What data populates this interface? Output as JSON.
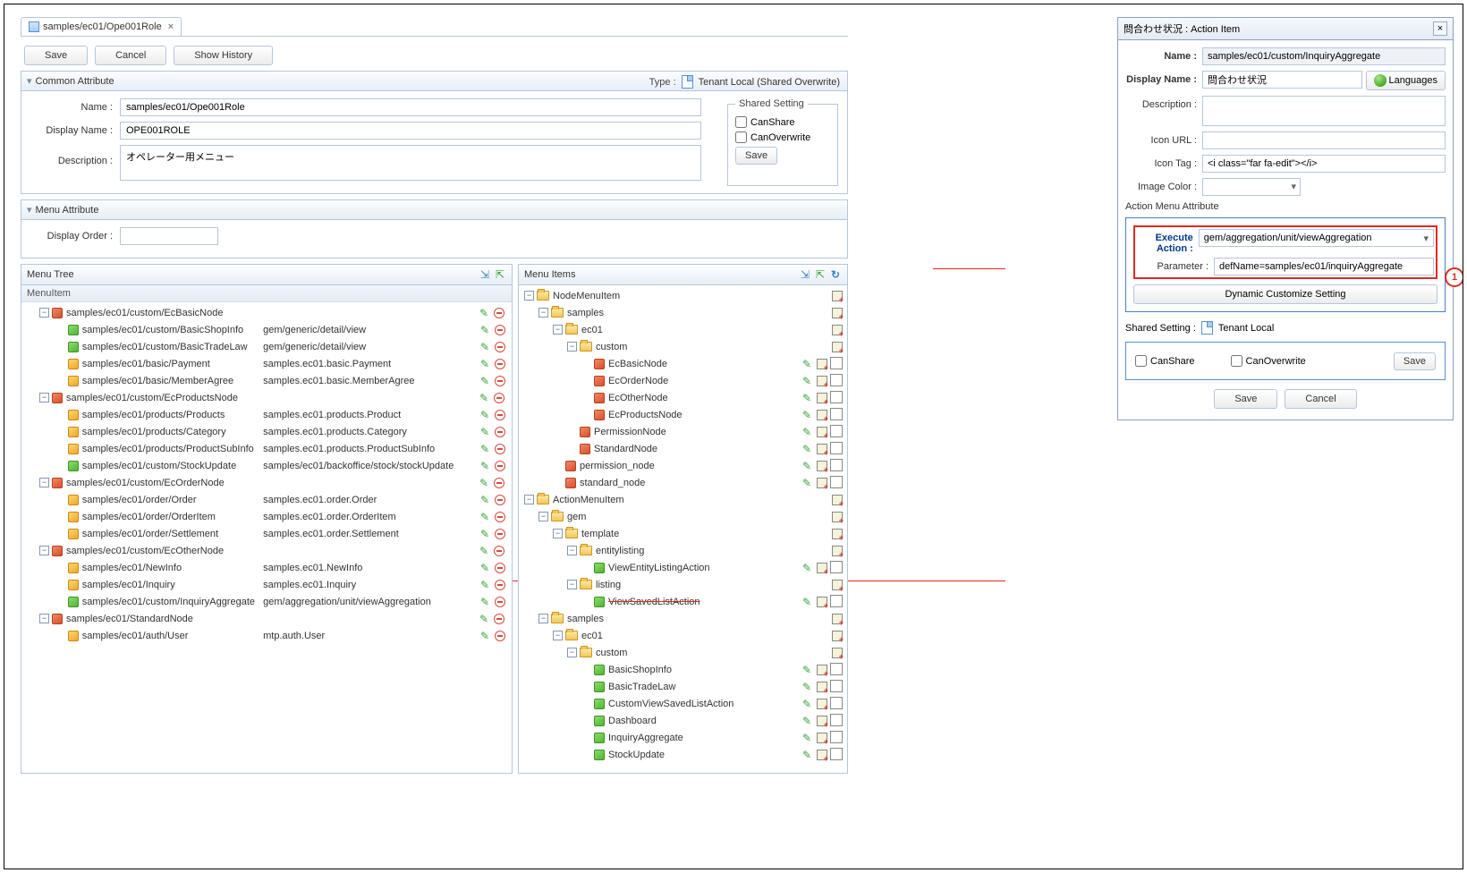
{
  "tab": {
    "title": "samples/ec01/Ope001Role"
  },
  "toolbar": {
    "save": "Save",
    "cancel": "Cancel",
    "history": "Show History"
  },
  "common": {
    "title": "Common Attribute",
    "name_lbl": "Name :",
    "name_val": "samples/ec01/Ope001Role",
    "disp_lbl": "Display Name :",
    "disp_val": "OPE001ROLE",
    "desc_lbl": "Description :",
    "desc_val": "オペレーター用メニュー",
    "type_lbl": "Type :",
    "type_val": "Tenant Local (Shared Overwrite)",
    "fs_title": "Shared Setting",
    "canshare": "CanShare",
    "canover": "CanOverwrite",
    "save": "Save"
  },
  "menuattr": {
    "title": "Menu Attribute",
    "disp_lbl": "Display Order :"
  },
  "panels": {
    "tree": "Menu Tree",
    "items": "Menu Items",
    "menuitem": "MenuItem"
  },
  "left_tree": [
    {
      "d": 0,
      "t": "-",
      "c": "red",
      "l": "samples/ec01/custom/EcBasicNode",
      "m": "",
      "ed": 1
    },
    {
      "d": 1,
      "t": "",
      "c": "green",
      "l": "samples/ec01/custom/BasicShopInfo",
      "m": "gem/generic/detail/view",
      "ed": 1
    },
    {
      "d": 1,
      "t": "",
      "c": "green",
      "l": "samples/ec01/custom/BasicTradeLaw",
      "m": "gem/generic/detail/view",
      "ed": 1
    },
    {
      "d": 1,
      "t": "",
      "c": "orange",
      "l": "samples/ec01/basic/Payment",
      "m": "samples.ec01.basic.Payment",
      "ed": 1
    },
    {
      "d": 1,
      "t": "",
      "c": "orange",
      "l": "samples/ec01/basic/MemberAgree",
      "m": "samples.ec01.basic.MemberAgree",
      "ed": 1
    },
    {
      "d": 0,
      "t": "-",
      "c": "red",
      "l": "samples/ec01/custom/EcProductsNode",
      "m": "",
      "ed": 1
    },
    {
      "d": 1,
      "t": "",
      "c": "orange",
      "l": "samples/ec01/products/Products",
      "m": "samples.ec01.products.Product",
      "ed": 1
    },
    {
      "d": 1,
      "t": "",
      "c": "orange",
      "l": "samples/ec01/products/Category",
      "m": "samples.ec01.products.Category",
      "ed": 1
    },
    {
      "d": 1,
      "t": "",
      "c": "orange",
      "l": "samples/ec01/products/ProductSubInfo",
      "m": "samples.ec01.products.ProductSubInfo",
      "ed": 1
    },
    {
      "d": 1,
      "t": "",
      "c": "green",
      "l": "samples/ec01/custom/StockUpdate",
      "m": "samples/ec01/backoffice/stock/stockUpdate",
      "ed": 1
    },
    {
      "d": 0,
      "t": "-",
      "c": "red",
      "l": "samples/ec01/custom/EcOrderNode",
      "m": "",
      "ed": 1
    },
    {
      "d": 1,
      "t": "",
      "c": "orange",
      "l": "samples/ec01/order/Order",
      "m": "samples.ec01.order.Order",
      "ed": 1
    },
    {
      "d": 1,
      "t": "",
      "c": "orange",
      "l": "samples/ec01/order/OrderItem",
      "m": "samples.ec01.order.OrderItem",
      "ed": 1
    },
    {
      "d": 1,
      "t": "",
      "c": "orange",
      "l": "samples/ec01/order/Settlement",
      "m": "samples.ec01.order.Settlement",
      "ed": 1
    },
    {
      "d": 0,
      "t": "-",
      "c": "red",
      "l": "samples/ec01/custom/EcOtherNode",
      "m": "",
      "ed": 1
    },
    {
      "d": 1,
      "t": "",
      "c": "orange",
      "l": "samples/ec01/NewInfo",
      "m": "samples.ec01.NewInfo",
      "ed": 1
    },
    {
      "d": 1,
      "t": "",
      "c": "orange",
      "l": "samples/ec01/Inquiry",
      "m": "samples.ec01.Inquiry",
      "ed": 1
    },
    {
      "d": 1,
      "t": "",
      "c": "green",
      "l": "samples/ec01/custom/InquiryAggregate",
      "m": "gem/aggregation/unit/viewAggregation",
      "ed": 1,
      "hl": 1
    },
    {
      "d": 0,
      "t": "-",
      "c": "red",
      "l": "samples/ec01/StandardNode",
      "m": "",
      "ed": 1
    },
    {
      "d": 1,
      "t": "",
      "c": "orange",
      "l": "samples/ec01/auth/User",
      "m": "mtp.auth.User",
      "ed": 1
    }
  ],
  "right_tree": [
    {
      "d": 0,
      "t": "-",
      "f": 1,
      "l": "NodeMenuItem",
      "a": "add"
    },
    {
      "d": 1,
      "t": "-",
      "f": 1,
      "l": "samples",
      "a": "add"
    },
    {
      "d": 2,
      "t": "-",
      "f": 1,
      "l": "ec01",
      "a": "add"
    },
    {
      "d": 3,
      "t": "-",
      "f": 1,
      "l": "custom",
      "a": "add"
    },
    {
      "d": 4,
      "t": "",
      "c": "red",
      "l": "EcBasicNode",
      "a": "edc"
    },
    {
      "d": 4,
      "t": "",
      "c": "red",
      "l": "EcOrderNode",
      "a": "edc"
    },
    {
      "d": 4,
      "t": "",
      "c": "red",
      "l": "EcOtherNode",
      "a": "edc"
    },
    {
      "d": 4,
      "t": "",
      "c": "red",
      "l": "EcProductsNode",
      "a": "edc"
    },
    {
      "d": 3,
      "t": "",
      "c": "red",
      "l": "PermissionNode",
      "a": "edc"
    },
    {
      "d": 3,
      "t": "",
      "c": "red",
      "l": "StandardNode",
      "a": "edc"
    },
    {
      "d": 2,
      "t": "",
      "c": "red",
      "l": "permission_node",
      "a": "edc"
    },
    {
      "d": 2,
      "t": "",
      "c": "red",
      "l": "standard_node",
      "a": "edc"
    },
    {
      "d": 0,
      "t": "-",
      "f": 1,
      "l": "ActionMenuItem",
      "a": "add"
    },
    {
      "d": 1,
      "t": "-",
      "f": 1,
      "l": "gem",
      "a": "add"
    },
    {
      "d": 2,
      "t": "-",
      "f": 1,
      "l": "template",
      "a": "add"
    },
    {
      "d": 3,
      "t": "-",
      "f": 1,
      "l": "entitylisting",
      "a": "add"
    },
    {
      "d": 4,
      "t": "",
      "c": "green",
      "l": "ViewEntityListingAction",
      "a": "edc"
    },
    {
      "d": 3,
      "t": "-",
      "f": 1,
      "l": "listing",
      "a": "add"
    },
    {
      "d": 4,
      "t": "",
      "c": "green",
      "l": "ViewSavedListAction",
      "a": "edc",
      "strike": 1
    },
    {
      "d": 1,
      "t": "-",
      "f": 1,
      "l": "samples",
      "a": "add"
    },
    {
      "d": 2,
      "t": "-",
      "f": 1,
      "l": "ec01",
      "a": "add"
    },
    {
      "d": 3,
      "t": "-",
      "f": 1,
      "l": "custom",
      "a": "add"
    },
    {
      "d": 4,
      "t": "",
      "c": "green",
      "l": "BasicShopInfo",
      "a": "edc"
    },
    {
      "d": 4,
      "t": "",
      "c": "green",
      "l": "BasicTradeLaw",
      "a": "edc"
    },
    {
      "d": 4,
      "t": "",
      "c": "green",
      "l": "CustomViewSavedListAction",
      "a": "edc"
    },
    {
      "d": 4,
      "t": "",
      "c": "green",
      "l": "Dashboard",
      "a": "edc"
    },
    {
      "d": 4,
      "t": "",
      "c": "green",
      "l": "InquiryAggregate",
      "a": "edc"
    },
    {
      "d": 4,
      "t": "",
      "c": "green",
      "l": "StockUpdate",
      "a": "edc"
    }
  ],
  "dlg": {
    "title": "問合わせ状況 : Action Item",
    "name_lbl": "Name :",
    "name_val": "samples/ec01/custom/InquiryAggregate",
    "disp_lbl": "Display Name :",
    "disp_val": "問合わせ状況",
    "lang": "Languages",
    "desc_lbl": "Description :",
    "iconurl_lbl": "Icon URL :",
    "icontag_lbl": "Icon Tag :",
    "icontag_val": "<i class=\"far fa-edit\"></i>",
    "imgcol_lbl": "Image Color :",
    "ama": "Action Menu Attribute",
    "exec_lbl": "Execute Action :",
    "exec_val": "gem/aggregation/unit/viewAggregation",
    "param_lbl": "Parameter :",
    "param_val": "defName=samples/ec01/inquiryAggregate",
    "dyn": "Dynamic Customize Setting",
    "ss_lbl": "Shared Setting :",
    "ss_val": "Tenant Local",
    "canshare": "CanShare",
    "canover": "CanOverwrite",
    "save": "Save",
    "foot_save": "Save",
    "foot_cancel": "Cancel"
  },
  "callout": "1"
}
